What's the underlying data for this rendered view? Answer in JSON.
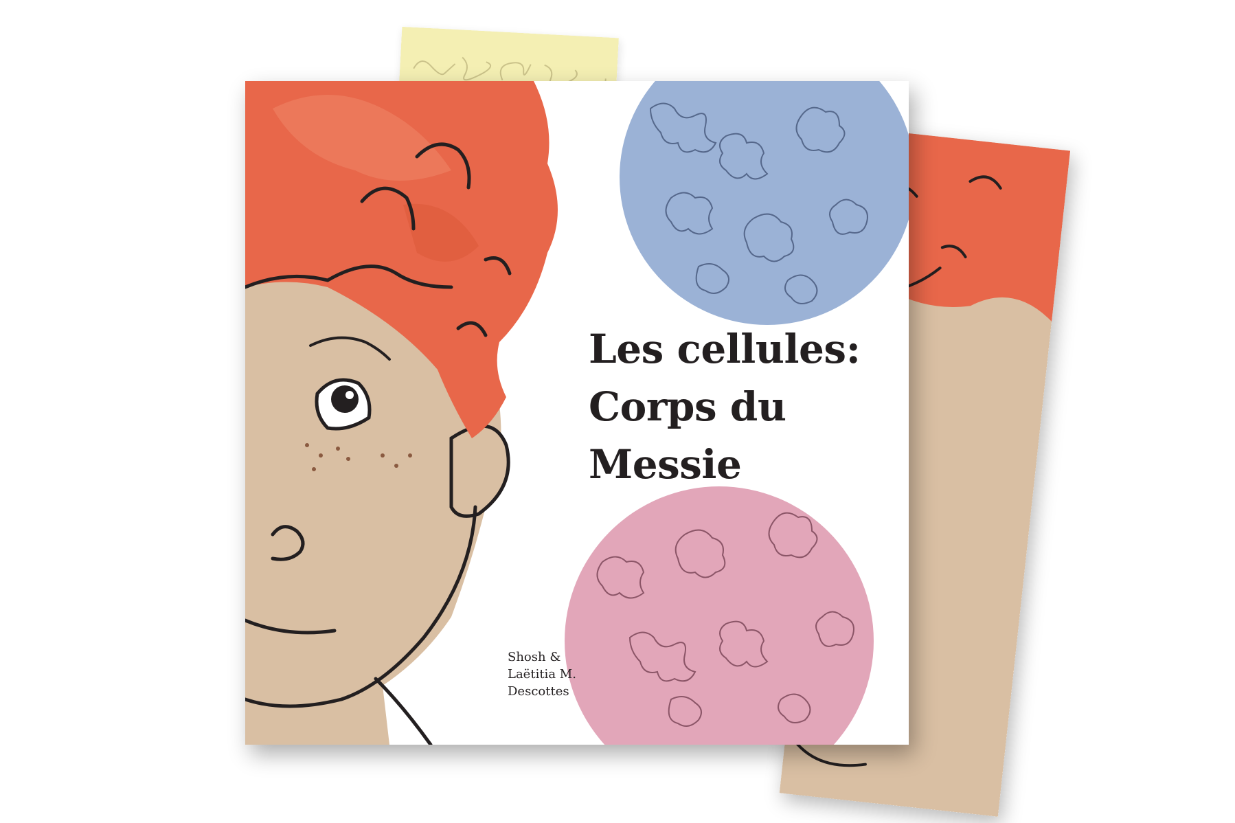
{
  "book": {
    "title_lines": [
      "Les cellules:",
      "Corps du",
      "Messie"
    ],
    "author_lines": [
      "Shosh &",
      "Laëtitia M.",
      "Descottes"
    ]
  },
  "colors": {
    "hair": "#e8674a",
    "skin": "#d9bfa3",
    "blue_circle": "#9bb2d6",
    "pink_circle": "#e2a6b9",
    "yellow_card": "#f4efb3",
    "ink": "#231f20"
  }
}
